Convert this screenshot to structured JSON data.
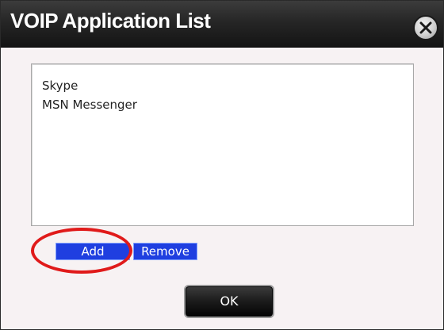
{
  "window": {
    "title": "VOIP Application List",
    "close_icon": "close-x-icon"
  },
  "app_list": {
    "items": [
      "Skype",
      "MSN Messenger"
    ]
  },
  "actions": {
    "add_label": "Add",
    "remove_label": "Remove",
    "ok_label": "OK"
  },
  "colors": {
    "titlebar": "#1e1e1e",
    "action_button": "#1f3fe0",
    "highlight": "#e01a1a",
    "dialog_bg": "#f7f2f3"
  }
}
